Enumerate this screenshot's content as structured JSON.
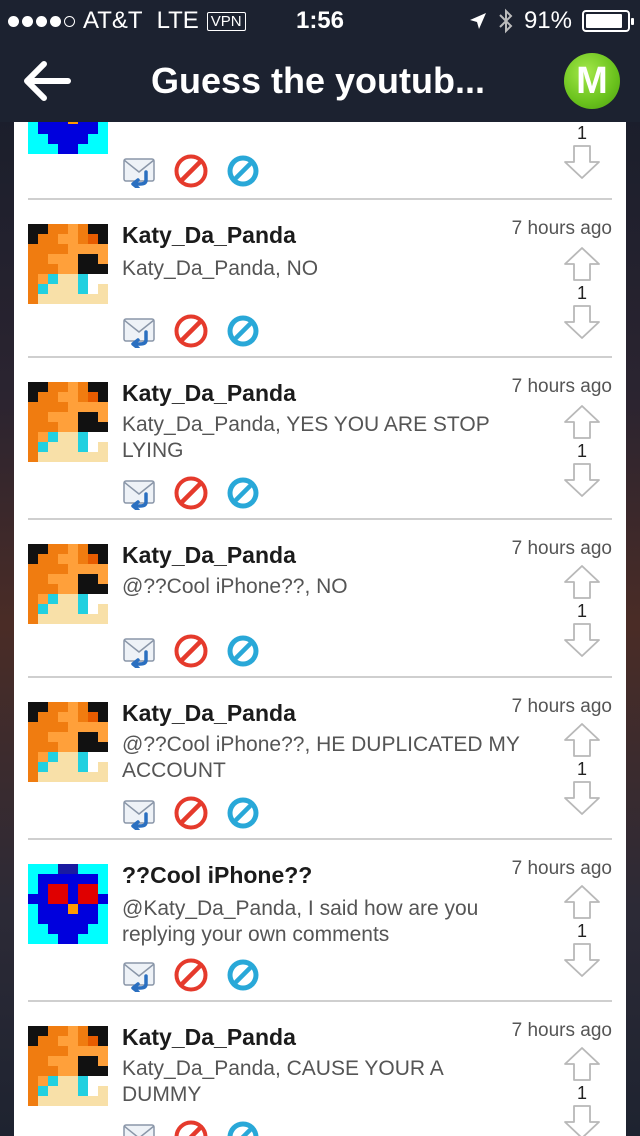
{
  "status_bar": {
    "carrier": "AT&T",
    "network": "LTE",
    "vpn": "VPN",
    "time": "1:56",
    "battery": "91%",
    "battery_level": 0.91
  },
  "nav": {
    "back_icon": "arrow-left-icon",
    "title": "Guess the youtub...",
    "logo_letter": "M"
  },
  "first_partial": {
    "vote_count": "1"
  },
  "comments": [
    {
      "username": "Katy_Da_Panda",
      "time": "7 hours ago",
      "message": "Katy_Da_Panda, NO",
      "votes": "1",
      "avatar": "panda"
    },
    {
      "username": "Katy_Da_Panda",
      "time": "7 hours ago",
      "message": "Katy_Da_Panda, YES YOU ARE STOP LYING",
      "votes": "1",
      "avatar": "panda"
    },
    {
      "username": "Katy_Da_Panda",
      "time": "7 hours ago",
      "message": "@??Cool iPhone??, NO",
      "votes": "1",
      "avatar": "panda"
    },
    {
      "username": "Katy_Da_Panda",
      "time": "7 hours ago",
      "message": "@??Cool iPhone??, HE DUPLICATED MY ACCOUNT",
      "votes": "1",
      "avatar": "panda"
    },
    {
      "username": "??Cool iPhone??",
      "time": "7 hours ago",
      "message": "@Katy_Da_Panda, I said how are you replying your own comments",
      "votes": "1",
      "avatar": "robot"
    },
    {
      "username": "Katy_Da_Panda",
      "time": "7 hours ago",
      "message": "Katy_Da_Panda, CAUSE YOUR A DUMMY",
      "votes": "1",
      "avatar": "panda"
    }
  ],
  "icons": {
    "reply": "reply-mail-icon",
    "report": "report-icon",
    "block": "block-icon",
    "upvote": "upvote-arrow-icon",
    "downvote": "downvote-arrow-icon"
  },
  "colors": {
    "bar": "#1c2230",
    "logo": "#6ac21d",
    "report": "#e53a2c",
    "block": "#29a8d8"
  }
}
